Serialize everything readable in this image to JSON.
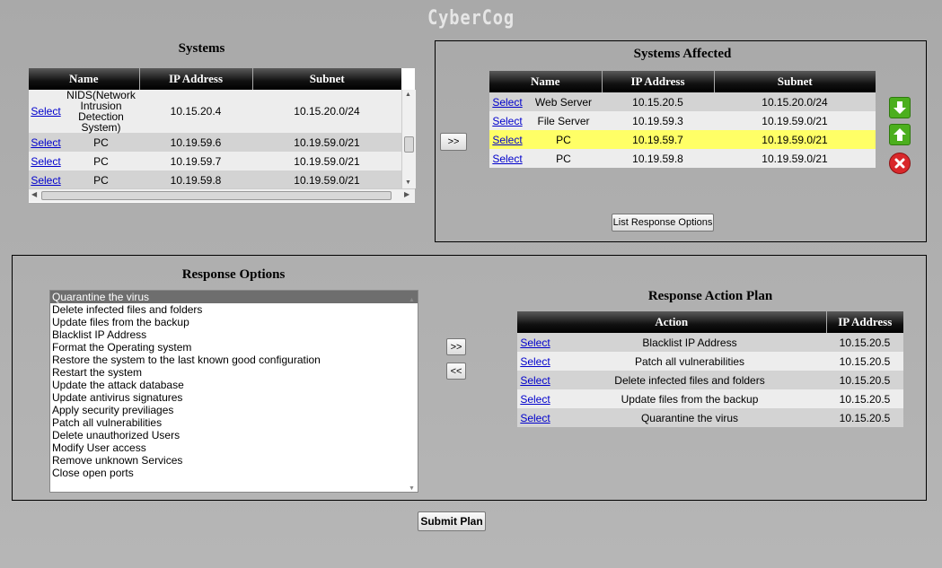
{
  "app": {
    "title": "CyberCog"
  },
  "systems": {
    "heading": "Systems",
    "columns": [
      "Name",
      "IP Address",
      "Subnet"
    ],
    "rows": [
      {
        "select": "Select",
        "name": "NIDS(Network Intrusion Detection System)",
        "ip": "10.15.20.4",
        "subnet": "10.15.20.0/24"
      },
      {
        "select": "Select",
        "name": "PC",
        "ip": "10.19.59.6",
        "subnet": "10.19.59.0/21"
      },
      {
        "select": "Select",
        "name": "PC",
        "ip": "10.19.59.7",
        "subnet": "10.19.59.0/21"
      },
      {
        "select": "Select",
        "name": "PC",
        "ip": "10.19.59.8",
        "subnet": "10.19.59.0/21"
      }
    ]
  },
  "affected": {
    "heading": "Systems Affected",
    "move_label": ">>",
    "columns": [
      "Name",
      "IP Address",
      "Subnet"
    ],
    "rows": [
      {
        "select": "Select",
        "name": "Web Server",
        "ip": "10.15.20.5",
        "subnet": "10.15.20.0/24"
      },
      {
        "select": "Select",
        "name": "File Server",
        "ip": "10.19.59.3",
        "subnet": "10.19.59.0/21"
      },
      {
        "select": "Select",
        "name": "PC",
        "ip": "10.19.59.7",
        "subnet": "10.19.59.0/21",
        "highlight": true
      },
      {
        "select": "Select",
        "name": "PC",
        "ip": "10.19.59.8",
        "subnet": "10.19.59.0/21"
      }
    ],
    "list_button": "List Response Options",
    "icons": {
      "down": "arrow-down-icon",
      "up": "arrow-up-icon",
      "remove": "close-icon"
    }
  },
  "response_options": {
    "heading": "Response Options",
    "items": [
      "Quarantine the virus",
      "Delete infected files and folders",
      "Update files from the backup",
      "Blacklist IP Address",
      "Format the Operating system",
      "Restore the system to the last known good configuration",
      "Restart the system",
      "Update the attack database",
      "Update antivirus signatures",
      "Apply security previliages",
      "Patch all vulnerabilities",
      "Delete unauthorized Users",
      "Modify User access",
      "Remove unknown Services",
      "Close open ports"
    ],
    "selected_index": 0,
    "add_label": ">>",
    "remove_label": "<<"
  },
  "plan": {
    "heading": "Response Action Plan",
    "columns": [
      "Action",
      "IP Address"
    ],
    "rows": [
      {
        "select": "Select",
        "action": "Blacklist IP Address",
        "ip": "10.15.20.5"
      },
      {
        "select": "Select",
        "action": "Patch all vulnerabilities",
        "ip": "10.15.20.5"
      },
      {
        "select": "Select",
        "action": "Delete infected files and folders",
        "ip": "10.15.20.5"
      },
      {
        "select": "Select",
        "action": "Update files from the backup",
        "ip": "10.15.20.5"
      },
      {
        "select": "Select",
        "action": "Quarantine the virus",
        "ip": "10.15.20.5"
      }
    ]
  },
  "submit_label": "Submit Plan",
  "colors": {
    "highlight": "#ffff66",
    "header": "#111111",
    "link": "#0000cc",
    "arrow": "#4caf1e",
    "remove": "#d9282b"
  }
}
